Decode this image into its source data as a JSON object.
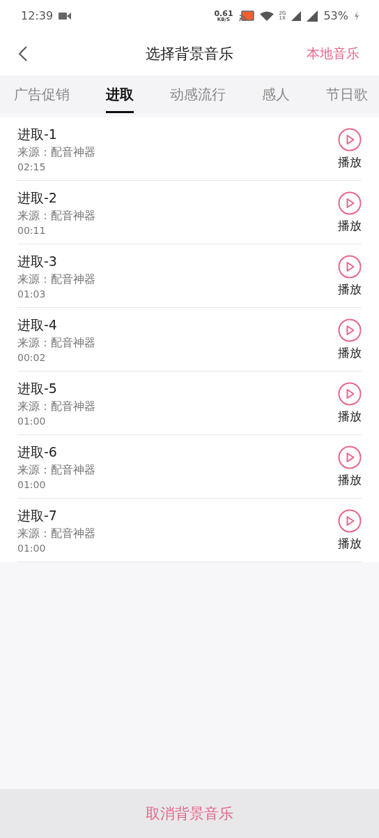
{
  "status_bar": {
    "time": "12:39",
    "speed_value": "0.61",
    "speed_unit": "KB/S",
    "network_top": "2G",
    "network_bottom": "1X",
    "battery": "53%"
  },
  "header": {
    "title": "选择背景音乐",
    "action": "本地音乐"
  },
  "tabs": [
    {
      "label": "广告促销",
      "selected": false
    },
    {
      "label": "进取",
      "selected": true
    },
    {
      "label": "动感流行",
      "selected": false
    },
    {
      "label": "感人",
      "selected": false
    },
    {
      "label": "节日歌",
      "selected": false
    }
  ],
  "tracks": [
    {
      "title": "进取-1",
      "source": "来源：配音神器",
      "duration": "02:15",
      "play_label": "播放"
    },
    {
      "title": "进取-2",
      "source": "来源：配音神器",
      "duration": "00:11",
      "play_label": "播放"
    },
    {
      "title": "进取-3",
      "source": "来源：配音神器",
      "duration": "01:03",
      "play_label": "播放"
    },
    {
      "title": "进取-4",
      "source": "来源：配音神器",
      "duration": "00:02",
      "play_label": "播放"
    },
    {
      "title": "进取-5",
      "source": "来源：配音神器",
      "duration": "01:00",
      "play_label": "播放"
    },
    {
      "title": "进取-6",
      "source": "来源：配音神器",
      "duration": "01:00",
      "play_label": "播放"
    },
    {
      "title": "进取-7",
      "source": "来源：配音神器",
      "duration": "01:00",
      "play_label": "播放"
    }
  ],
  "cancel_button": "取消背景音乐"
}
